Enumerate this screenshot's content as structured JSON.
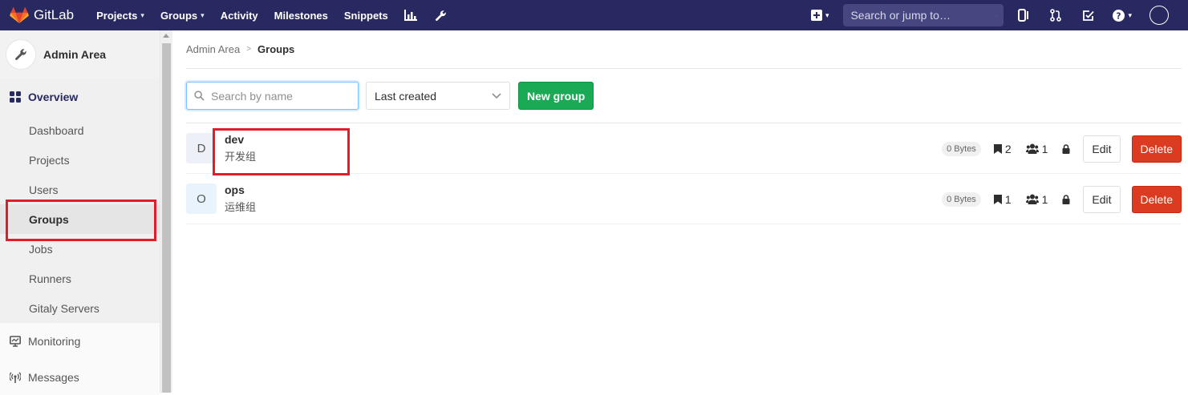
{
  "navbar": {
    "brand": "GitLab",
    "links": [
      {
        "label": "Projects",
        "caret": true
      },
      {
        "label": "Groups",
        "caret": true
      },
      {
        "label": "Activity",
        "caret": false
      },
      {
        "label": "Milestones",
        "caret": false
      },
      {
        "label": "Snippets",
        "caret": false
      }
    ],
    "search_placeholder": "Search or jump to…"
  },
  "sidebar": {
    "title": "Admin Area",
    "section": "Overview",
    "sub_items": [
      "Dashboard",
      "Projects",
      "Users",
      "Groups",
      "Jobs",
      "Runners",
      "Gitaly Servers"
    ],
    "active_item": "Groups",
    "main_items": [
      "Monitoring",
      "Messages"
    ]
  },
  "breadcrumb": {
    "parent": "Admin Area",
    "current": "Groups"
  },
  "filter": {
    "search_placeholder": "Search by name",
    "sort_value": "Last created",
    "new_group_label": "New group"
  },
  "groups": [
    {
      "initial": "D",
      "name": "dev",
      "description": "开发组",
      "size": "0 Bytes",
      "projects": "2",
      "members": "1",
      "edit_label": "Edit",
      "delete_label": "Delete",
      "avatar_color": "#eef0f8"
    },
    {
      "initial": "O",
      "name": "ops",
      "description": "运维组",
      "size": "0 Bytes",
      "projects": "1",
      "members": "1",
      "edit_label": "Edit",
      "delete_label": "Delete",
      "avatar_color": "#e8f3fd"
    }
  ],
  "colors": {
    "navbar": "#292961",
    "primary_green": "#1aaa55",
    "danger_red": "#db3b21",
    "highlight_red": "#e21c2a"
  }
}
